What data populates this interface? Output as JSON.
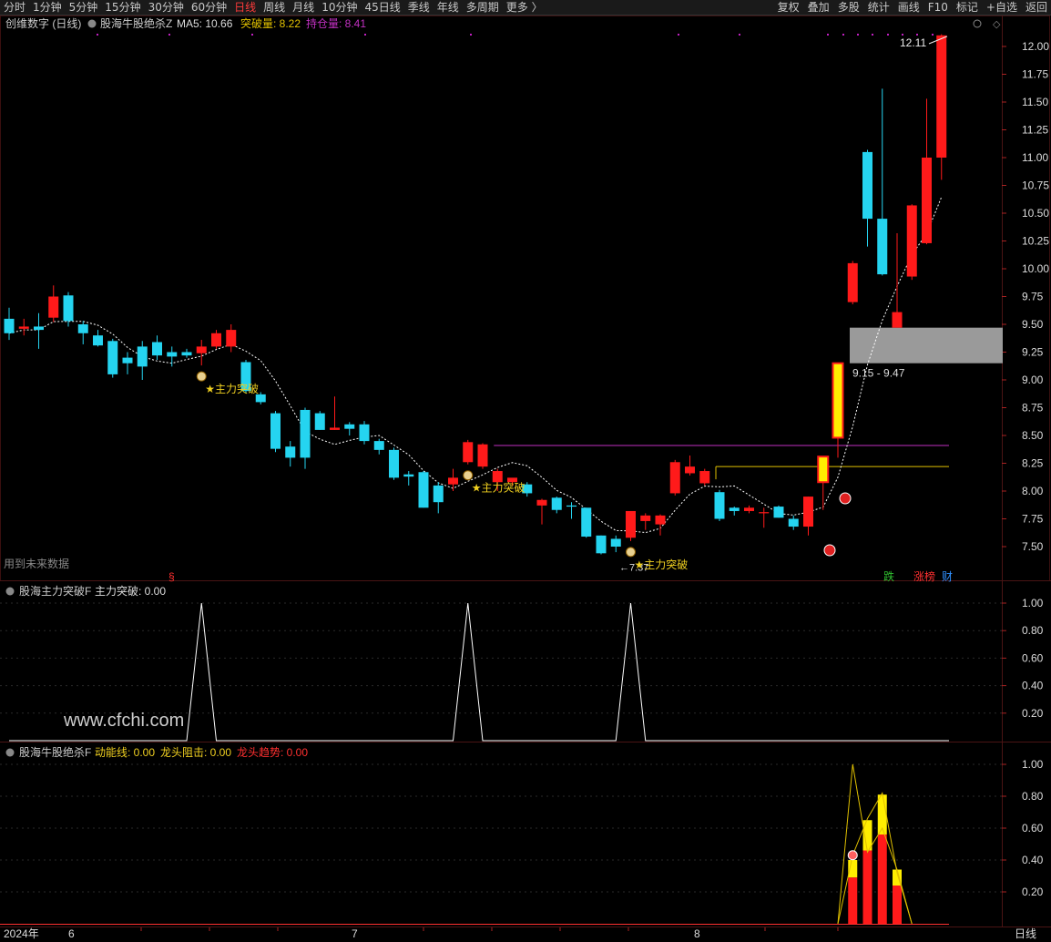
{
  "toolbar": {
    "tabs": [
      "分时",
      "1分钟",
      "5分钟",
      "15分钟",
      "30分钟",
      "60分钟",
      "日线",
      "周线",
      "月线",
      "10分钟",
      "45日线",
      "季线",
      "年线",
      "多周期",
      "更多 〉"
    ],
    "active": "日线",
    "right": [
      "复权",
      "叠加",
      "多股",
      "统计",
      "画线",
      "F10",
      "标记",
      "+自选",
      "返回"
    ]
  },
  "main_header": {
    "stock": "创维数字 (日线)",
    "indicator": "股海牛股绝杀Z",
    "ma_label": "MA5: 10.66",
    "break_label": "突破量: 8.22",
    "hold_label": "持仓量: 8.41"
  },
  "sub1_header": {
    "indicator": "股海主力突破F",
    "value_label": "主力突破: 0.00"
  },
  "sub2_header": {
    "indicator": "股海牛股绝杀F",
    "l1": "动能线: 0.00",
    "l2": "龙头阻击: 0.00",
    "l3": "龙头趋势: 0.00"
  },
  "footer": {
    "year": "2024年",
    "m6": "6",
    "m7": "7",
    "m8": "8",
    "period": "日线"
  },
  "notes": {
    "future": "用到未来数据",
    "watermark": "www.cfchi.com",
    "s_mark": "§",
    "zone": "9.15 - 9.47",
    "high": "12.11",
    "low": "7.37"
  },
  "signals": {
    "label": "★主力突破"
  },
  "badges": {
    "die": "跌",
    "zhang": "涨榜",
    "cai": "财"
  },
  "colors": {
    "up": "#ff1a1a",
    "down": "#25d4f0",
    "ma": "#ffffff",
    "break": "#e0c000",
    "hold": "#c030c0",
    "zone": "#9a9a9a",
    "bg": "#000000"
  },
  "chart_data": [
    {
      "type": "candlestick",
      "name": "main",
      "ylim": [
        7.3,
        12.15
      ],
      "yticks": [
        7.5,
        7.75,
        8.0,
        8.25,
        8.5,
        8.75,
        9.0,
        9.25,
        9.5,
        9.75,
        10.0,
        10.25,
        10.5,
        10.75,
        11.0,
        11.25,
        11.5,
        11.75,
        12.0
      ],
      "candles": [
        [
          9.55,
          9.42,
          9.65,
          9.36
        ],
        [
          9.46,
          9.48,
          9.55,
          9.4
        ],
        [
          9.48,
          9.45,
          9.6,
          9.28
        ],
        [
          9.56,
          9.75,
          9.85,
          9.52
        ],
        [
          9.76,
          9.53,
          9.79,
          9.48
        ],
        [
          9.5,
          9.42,
          9.53,
          9.32
        ],
        [
          9.4,
          9.31,
          9.45,
          9.3
        ],
        [
          9.35,
          9.05,
          9.37,
          9.02
        ],
        [
          9.2,
          9.15,
          9.25,
          9.05
        ],
        [
          9.3,
          9.12,
          9.35,
          9.0
        ],
        [
          9.34,
          9.22,
          9.4,
          9.18
        ],
        [
          9.25,
          9.21,
          9.3,
          9.12
        ],
        [
          9.25,
          9.22,
          9.28,
          9.2
        ],
        [
          9.24,
          9.3,
          9.36,
          9.13
        ],
        [
          9.3,
          9.42,
          9.45,
          9.28
        ],
        [
          9.3,
          9.45,
          9.5,
          9.25
        ],
        [
          9.16,
          8.9,
          9.18,
          8.88
        ],
        [
          8.87,
          8.8,
          8.89,
          8.78
        ],
        [
          8.7,
          8.38,
          8.72,
          8.35
        ],
        [
          8.4,
          8.3,
          8.45,
          8.22
        ],
        [
          8.73,
          8.3,
          8.75,
          8.2
        ],
        [
          8.7,
          8.55,
          8.72,
          8.55
        ],
        [
          8.55,
          8.57,
          8.85,
          8.55
        ],
        [
          8.6,
          8.56,
          8.62,
          8.5
        ],
        [
          8.6,
          8.45,
          8.63,
          8.42
        ],
        [
          8.45,
          8.37,
          8.47,
          8.33
        ],
        [
          8.37,
          8.12,
          8.39,
          8.1
        ],
        [
          8.15,
          8.13,
          8.18,
          8.05
        ],
        [
          8.17,
          7.85,
          8.18,
          7.85
        ],
        [
          8.05,
          7.9,
          8.08,
          7.8
        ],
        [
          8.06,
          8.12,
          8.2,
          8.0
        ],
        [
          8.26,
          8.44,
          8.46,
          8.24
        ],
        [
          8.22,
          8.42,
          8.43,
          8.2
        ],
        [
          8.08,
          8.18,
          8.2,
          8.0
        ],
        [
          8.08,
          8.12,
          8.1,
          8.05
        ],
        [
          8.06,
          7.98,
          8.08,
          7.95
        ],
        [
          7.87,
          7.92,
          7.93,
          7.7
        ],
        [
          7.94,
          7.83,
          7.95,
          7.8
        ],
        [
          7.87,
          7.86,
          7.9,
          7.75
        ],
        [
          7.85,
          7.59,
          7.85,
          7.58
        ],
        [
          7.6,
          7.44,
          7.6,
          7.43
        ],
        [
          7.57,
          7.5,
          7.6,
          7.45
        ],
        [
          7.58,
          7.82,
          7.8,
          7.55
        ],
        [
          7.73,
          7.78,
          7.8,
          7.65
        ],
        [
          7.7,
          7.78,
          7.79,
          7.6
        ],
        [
          7.98,
          8.26,
          8.28,
          7.96
        ],
        [
          8.16,
          8.22,
          8.32,
          8.14
        ],
        [
          8.07,
          8.18,
          8.2,
          8.05
        ],
        [
          7.99,
          7.75,
          8.01,
          7.73
        ],
        [
          7.85,
          7.82,
          7.86,
          7.78
        ],
        [
          7.82,
          7.85,
          7.87,
          7.8
        ],
        [
          7.8,
          7.81,
          7.85,
          7.67
        ],
        [
          7.86,
          7.76,
          7.87,
          7.76
        ],
        [
          7.75,
          7.68,
          7.78,
          7.65
        ],
        [
          7.68,
          7.95,
          7.95,
          7.6
        ],
        [
          8.31,
          8.08,
          8.3,
          7.83
        ],
        [
          8.48,
          9.15,
          9.15,
          8.3
        ],
        [
          9.7,
          10.05,
          10.07,
          9.68
        ],
        [
          11.05,
          10.45,
          11.07,
          10.2
        ],
        [
          10.45,
          9.95,
          11.62,
          9.94
        ],
        [
          9.47,
          9.61,
          10.32,
          9.47
        ],
        [
          9.93,
          10.57,
          10.58,
          9.9
        ],
        [
          10.23,
          11.0,
          11.53,
          10.22
        ],
        [
          11.0,
          12.1,
          12.11,
          10.8
        ]
      ],
      "color_override": {
        "56": "yellow",
        "55": "yellow"
      },
      "break_level": 8.22,
      "hold_level": 8.41,
      "zone": [
        9.15,
        9.47
      ],
      "signal_indices": [
        13,
        31,
        42
      ]
    },
    {
      "type": "line",
      "name": "股海主力突破F",
      "ylim": [
        0,
        1.1
      ],
      "yticks": [
        0.2,
        0.4,
        0.6,
        0.8,
        1.0
      ],
      "peaks_at": [
        13,
        31,
        42
      ],
      "peak_value": 1.0
    },
    {
      "type": "bar",
      "name": "股海牛股绝杀F",
      "ylim": [
        0,
        1.12
      ],
      "yticks": [
        0.2,
        0.4,
        0.6,
        0.8,
        1.0
      ],
      "bars": [
        {
          "i": 57,
          "red": 0.29,
          "yellow": 0.4
        },
        {
          "i": 58,
          "red": 0.46,
          "yellow": 0.65
        },
        {
          "i": 59,
          "red": 0.56,
          "yellow": 0.81
        },
        {
          "i": 60,
          "red": 0.24,
          "yellow": 0.34
        }
      ],
      "tri": [
        [
          56,
          0
        ],
        [
          57,
          1.0
        ],
        [
          58,
          0.45
        ],
        [
          59,
          0.6
        ],
        [
          60,
          0.34
        ],
        [
          61,
          0
        ]
      ]
    }
  ]
}
